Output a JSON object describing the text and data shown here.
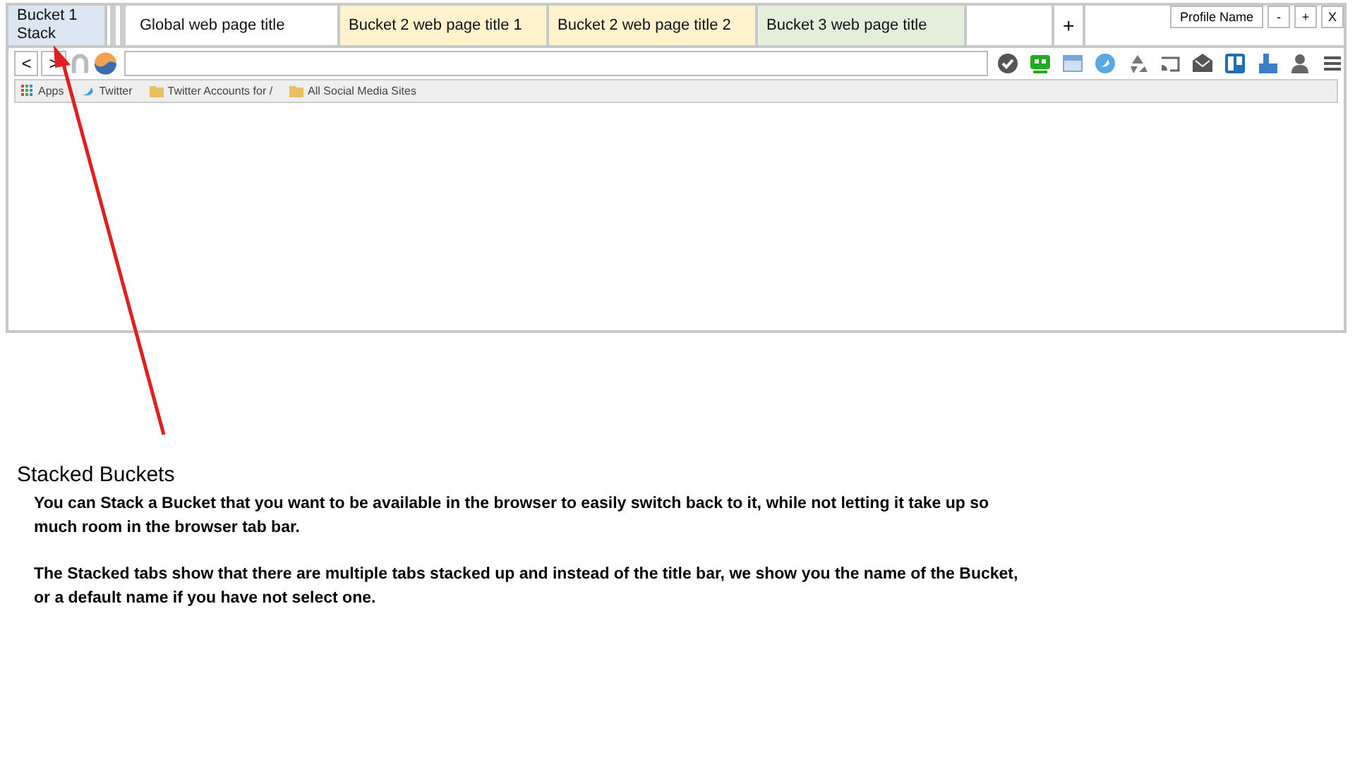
{
  "tabs": [
    {
      "kind": "stack",
      "label": "Bucket 1 Stack",
      "color": "#dce6f2"
    },
    {
      "kind": "page",
      "label": "Global web page title",
      "color": "#ffffff"
    },
    {
      "kind": "page",
      "label": "Bucket 2 web page title 1",
      "color": "#fff2cc"
    },
    {
      "kind": "page",
      "label": "Bucket 2 web page title 2",
      "color": "#fff2cc"
    },
    {
      "kind": "page",
      "label": "Bucket 3 web page title",
      "color": "#e2efda"
    }
  ],
  "new_tab": "+",
  "profile": {
    "name": "Profile Name",
    "controls": [
      "-",
      "+",
      "X"
    ]
  },
  "nav": {
    "back": "<",
    "forward": ">"
  },
  "bookmarks": [
    {
      "kind": "apps",
      "label": "Apps"
    },
    {
      "kind": "bird",
      "label": "Twitter"
    },
    {
      "kind": "folder",
      "label": "Twitter Accounts for /"
    },
    {
      "kind": "folder",
      "label": "All Social Media Sites"
    }
  ],
  "note": {
    "title": "Stacked Buckets",
    "paragraphs": [
      "You can Stack a Bucket that you want to be available in the browser to easily switch back to it, while not letting it take up so much room in the browser tab bar.",
      "The Stacked tabs show that there are multiple tabs stacked up and instead of the title bar, we show you the name of the Bucket, or a default name if you have not select one."
    ]
  }
}
